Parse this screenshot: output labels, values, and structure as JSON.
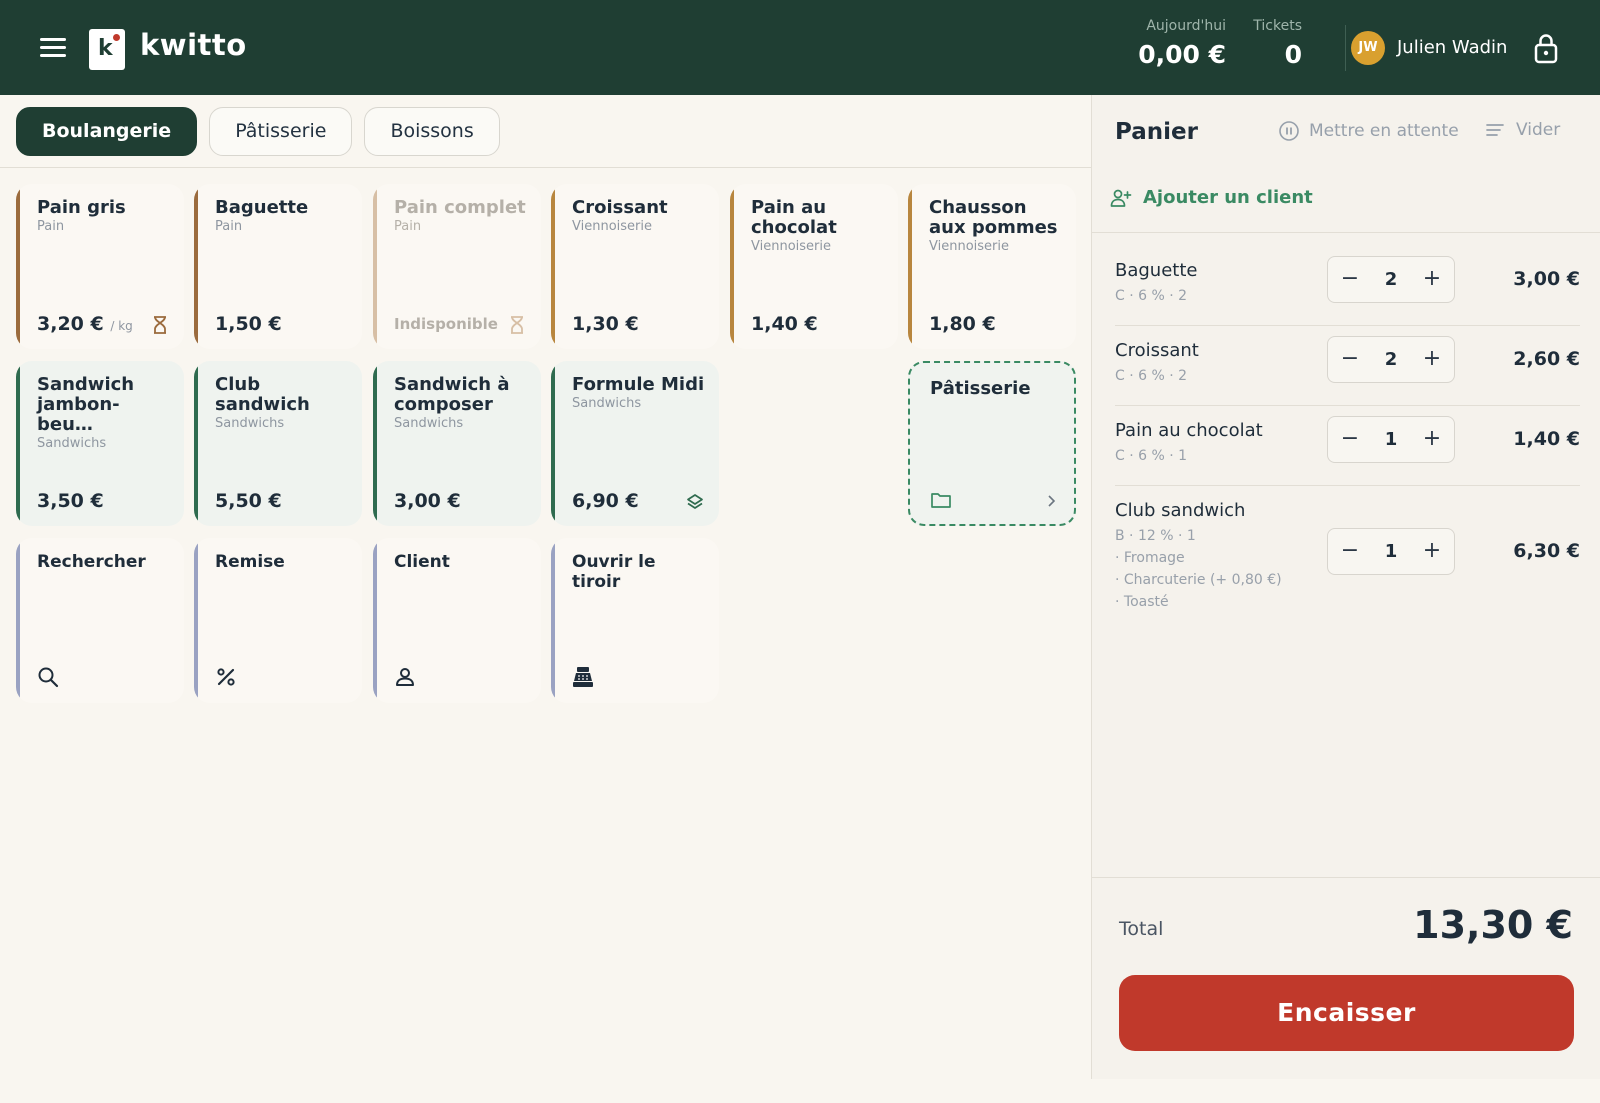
{
  "header": {
    "app_name": "kwitto",
    "logo_letter": "k",
    "today_label": "Aujourd'hui",
    "today_value": "0,00 €",
    "tickets_label": "Tickets",
    "tickets_value": "0",
    "user_initials": "JW",
    "user_name": "Julien Wadin"
  },
  "tabs": [
    {
      "label": "Boulangerie",
      "active": true
    },
    {
      "label": "Pâtisserie",
      "active": false
    },
    {
      "label": "Boissons",
      "active": false
    }
  ],
  "products": [
    {
      "name": "Pain gris",
      "category": "Pain",
      "price": "3,20 €",
      "unit": "/ kg",
      "badge": "hourglass-icon"
    },
    {
      "name": "Baguette",
      "category": "Pain",
      "price": "1,50 €"
    },
    {
      "name": "Pain complet",
      "category": "Pain",
      "status": "Indisponible",
      "badge": "hourglass-icon"
    },
    {
      "name": "Croissant",
      "category": "Viennoiserie",
      "price": "1,30 €"
    },
    {
      "name": "Pain au chocolat",
      "category": "Viennoiserie",
      "price": "1,40 €"
    },
    {
      "name": "Chausson aux pommes",
      "category": "Viennoiserie",
      "price": "1,80 €"
    },
    {
      "name": "Sandwich jambon-beu…",
      "category": "Sandwichs",
      "price": "3,50 €"
    },
    {
      "name": "Club sandwich",
      "category": "Sandwichs",
      "price": "5,50 €"
    },
    {
      "name": "Sandwich à composer",
      "category": "Sandwichs",
      "price": "3,00 €"
    },
    {
      "name": "Formule Midi",
      "category": "Sandwichs",
      "price": "6,90 €",
      "badge": "layers-icon"
    }
  ],
  "folder": {
    "name": "Pâtisserie"
  },
  "actions": [
    {
      "label": "Rechercher",
      "icon": "search-icon"
    },
    {
      "label": "Remise",
      "icon": "percent-icon"
    },
    {
      "label": "Client",
      "icon": "user-icon"
    },
    {
      "label": "Ouvrir le tiroir",
      "icon": "cash-register-icon"
    }
  ],
  "cart": {
    "title": "Panier",
    "hold_label": "Mettre en attente",
    "clear_label": "Vider",
    "add_client_label": "Ajouter un client",
    "lines": [
      {
        "name": "Baguette",
        "meta": "C · 6 % · 2",
        "qty": "2",
        "price": "3,00 €",
        "options": []
      },
      {
        "name": "Croissant",
        "meta": "C · 6 % · 2",
        "qty": "2",
        "price": "2,60 €",
        "options": []
      },
      {
        "name": "Pain au chocolat",
        "meta": "C · 6 % · 1",
        "qty": "1",
        "price": "1,40 €",
        "options": []
      },
      {
        "name": "Club sandwich",
        "meta": "B · 12 % · 1",
        "qty": "1",
        "price": "6,30 €",
        "options": [
          "· Fromage",
          "· Charcuterie (+ 0,80 €)",
          "· Toasté"
        ]
      }
    ],
    "total_label": "Total",
    "total_value": "13,30 €",
    "pay_label": "Encaisser"
  },
  "colors": {
    "header_bg": "#1f3e33",
    "accent_red": "#c0392b",
    "accent_green": "#3a8a63",
    "bread_bar": "#9b6b3d",
    "sandwich_bar": "#2f6b4f",
    "action_bar": "#9aa2c2"
  }
}
